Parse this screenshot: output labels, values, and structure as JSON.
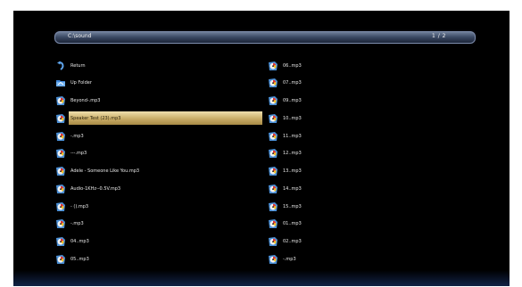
{
  "path_bar": {
    "path": "C:\\sound",
    "page": "1 / 2"
  },
  "left_column": [
    {
      "label": "Return",
      "icon": "return-arrow-icon"
    },
    {
      "label": "Up Folder",
      "icon": "folder-icon"
    },
    {
      "label": "Beyond-.mp3",
      "icon": "music-file-icon"
    },
    {
      "label": "Speaker Test (23).mp3",
      "icon": "music-file-icon",
      "selected": true
    },
    {
      "label": "-.mp3",
      "icon": "music-file-icon"
    },
    {
      "label": "---.mp3",
      "icon": "music-file-icon"
    },
    {
      "label": "Adele - Someone Like You.mp3",
      "icon": "music-file-icon"
    },
    {
      "label": "Audio-1KHz--0.5V.mp3",
      "icon": "music-file-icon"
    },
    {
      "label": "- ().mp3",
      "icon": "music-file-icon"
    },
    {
      "label": "-.mp3",
      "icon": "music-file-icon"
    },
    {
      "label": "04..mp3",
      "icon": "music-file-icon"
    },
    {
      "label": "05..mp3",
      "icon": "music-file-icon"
    }
  ],
  "right_column": [
    {
      "label": "06..mp3",
      "icon": "music-file-icon"
    },
    {
      "label": "07..mp3",
      "icon": "music-file-icon"
    },
    {
      "label": "09..mp3",
      "icon": "music-file-icon"
    },
    {
      "label": "10..mp3",
      "icon": "music-file-icon"
    },
    {
      "label": "11..mp3",
      "icon": "music-file-icon"
    },
    {
      "label": "12..mp3",
      "icon": "music-file-icon"
    },
    {
      "label": "13..mp3",
      "icon": "music-file-icon"
    },
    {
      "label": "14..mp3",
      "icon": "music-file-icon"
    },
    {
      "label": "15..mp3",
      "icon": "music-file-icon"
    },
    {
      "label": "01..mp3",
      "icon": "music-file-icon"
    },
    {
      "label": "02..mp3",
      "icon": "music-file-icon"
    },
    {
      "label": "-.mp3",
      "icon": "music-file-icon"
    }
  ],
  "colors": {
    "selection": "#d8c17f",
    "pathbar": "#4a5a78",
    "background": "#000000"
  }
}
